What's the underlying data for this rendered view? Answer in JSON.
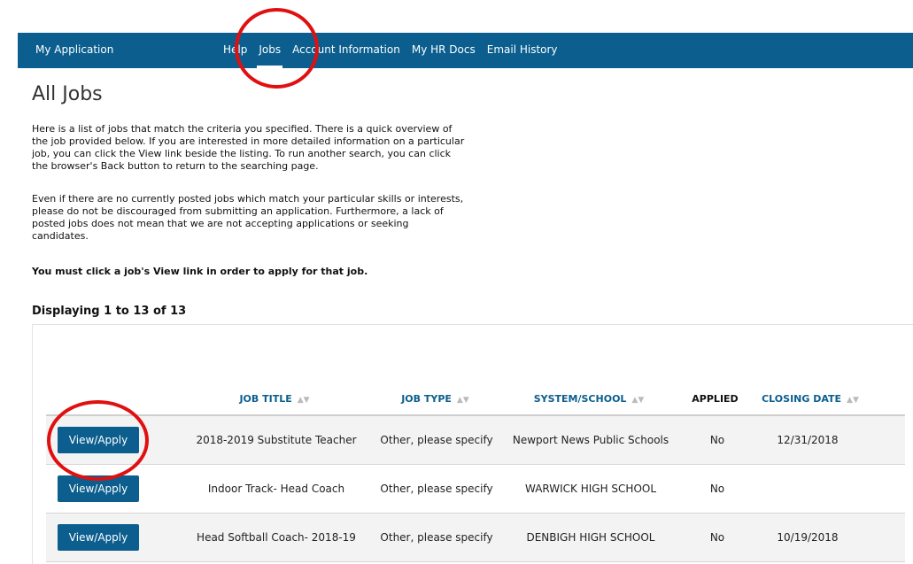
{
  "header": {
    "brand": "My Application",
    "nav": [
      "Help",
      "Jobs",
      "Account Information",
      "My HR Docs",
      "Email History"
    ],
    "active": "Jobs"
  },
  "page": {
    "title": "All Jobs",
    "intro": "Here is a list of jobs that match the criteria you specified. There is a quick overview of the job provided below. If you are interested in more detailed information on a particular job, you can click the View link beside the listing. To run another search, you can click the browser's Back button to return to the searching page.",
    "encourage": "Even if there are no currently posted jobs which match your particular skills or interests, please do not be discouraged from submitting an application. Furthermore, a lack of posted jobs does not mean that we are not accepting applications or seeking candidates.",
    "note": "You must click a job's View link in order to apply for that job.",
    "displaying": "Displaying 1 to 13 of 13"
  },
  "table": {
    "columns": [
      "JOB TITLE",
      "JOB TYPE",
      "SYSTEM/SCHOOL",
      "APPLIED",
      "CLOSING DATE"
    ],
    "action_label": "View/Apply",
    "rows": [
      {
        "title": "2018-2019 Substitute Teacher",
        "type": "Other, please specify",
        "school": "Newport News Public Schools",
        "applied": "No",
        "closing": "12/31/2018"
      },
      {
        "title": "Indoor Track- Head Coach",
        "type": "Other, please specify",
        "school": "WARWICK HIGH SCHOOL",
        "applied": "No",
        "closing": ""
      },
      {
        "title": "Head Softball Coach- 2018-19",
        "type": "Other, please specify",
        "school": "DENBIGH HIGH SCHOOL",
        "applied": "No",
        "closing": "10/19/2018"
      }
    ]
  },
  "colors": {
    "nav_bg": "#0b5e8e",
    "accent": "#0b5e8e",
    "highlight_circle": "#e01010"
  },
  "icons": {
    "sort": "sort-arrows-icon"
  }
}
